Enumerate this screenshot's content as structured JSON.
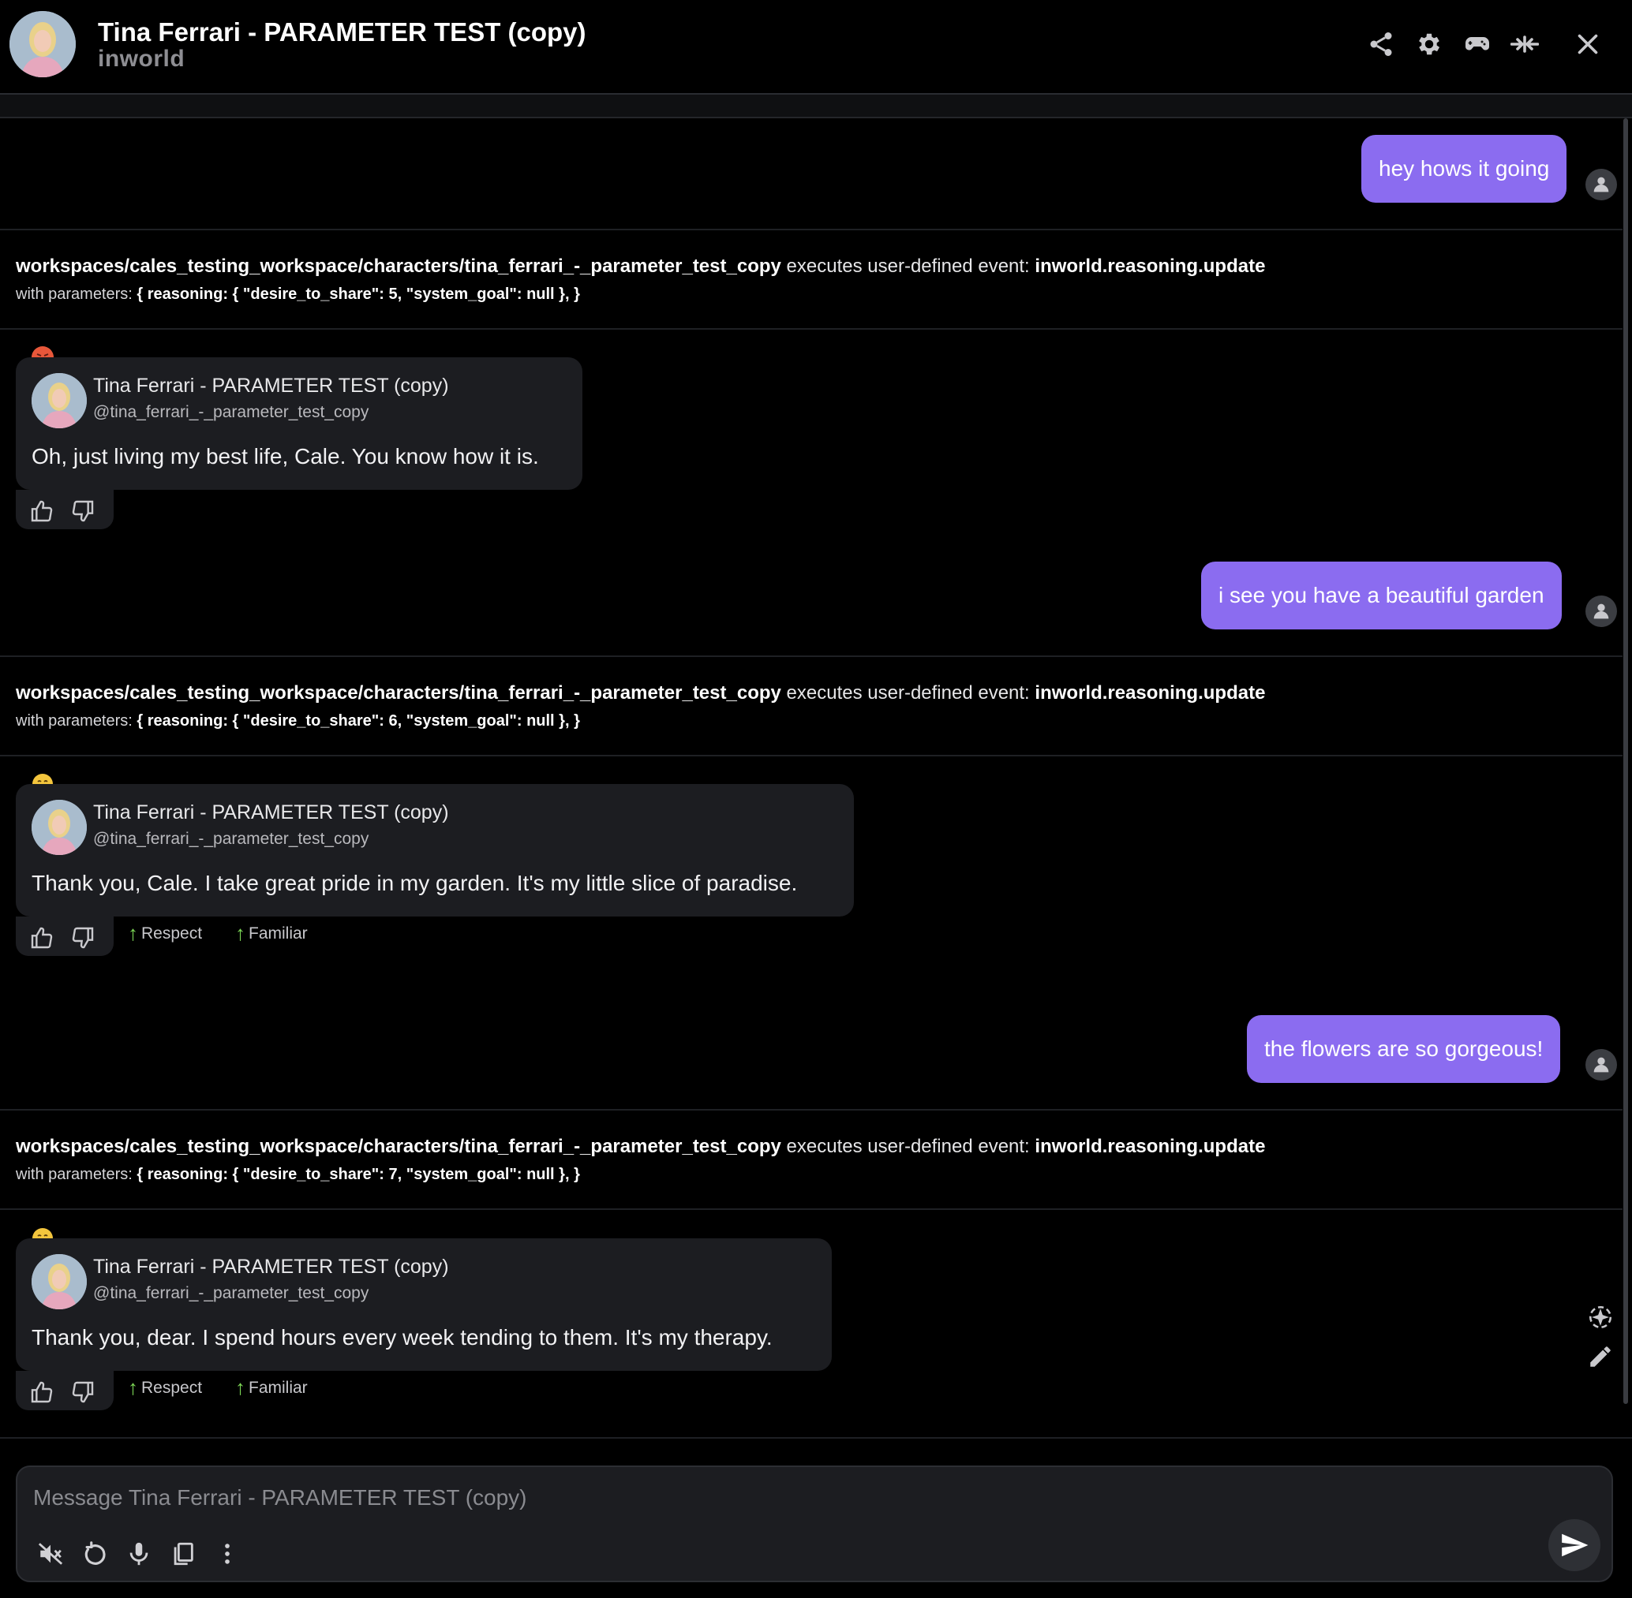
{
  "header": {
    "title": "Tina Ferrari - PARAMETER TEST (copy)",
    "brand": "inworld",
    "icons": [
      "share-icon",
      "gear-icon",
      "gamepad-icon",
      "collapse-icon",
      "close-icon"
    ]
  },
  "character": {
    "name": "Tina Ferrari - PARAMETER TEST (copy)",
    "handle": "@tina_ferrari_-_parameter_test_copy"
  },
  "event": {
    "path": "workspaces/cales_testing_workspace/characters/tina_ferrari_-_parameter_test_copy",
    "executes": "executes user-defined event:",
    "name": "inworld.reasoning.update",
    "with": "with parameters:"
  },
  "messages": [
    {
      "type": "user",
      "text": "hey hows it going"
    },
    {
      "type": "event",
      "params": "{ reasoning: { \"desire_to_share\": 5, \"system_goal\": null }, }"
    },
    {
      "type": "bot",
      "emotion": "angry",
      "text": "Oh, just living my best life, Cale. You know how it is.",
      "relations": []
    },
    {
      "type": "user",
      "text": "i see you have a beautiful garden"
    },
    {
      "type": "event",
      "params": "{ reasoning: { \"desire_to_share\": 6, \"system_goal\": null }, }"
    },
    {
      "type": "bot",
      "emotion": "joy",
      "text": "Thank you, Cale. I take great pride in my garden. It's my little slice of paradise.",
      "relations": [
        "Respect",
        "Familiar"
      ]
    },
    {
      "type": "user",
      "text": "the flowers are so gorgeous!"
    },
    {
      "type": "event",
      "params": "{ reasoning: { \"desire_to_share\": 7, \"system_goal\": null }, }"
    },
    {
      "type": "bot",
      "emotion": "joy",
      "text": "Thank you, dear. I spend hours every week tending to them. It's my therapy.",
      "relations": [
        "Respect",
        "Familiar"
      ]
    }
  ],
  "relation_arrow": "↑",
  "input": {
    "placeholder": "Message Tina Ferrari - PARAMETER TEST (copy)",
    "value": ""
  },
  "colors": {
    "user_bubble": "#8b6cf0",
    "bot_bubble": "#1c1d21",
    "background": "#000000",
    "relation_up": "#7ed957"
  }
}
